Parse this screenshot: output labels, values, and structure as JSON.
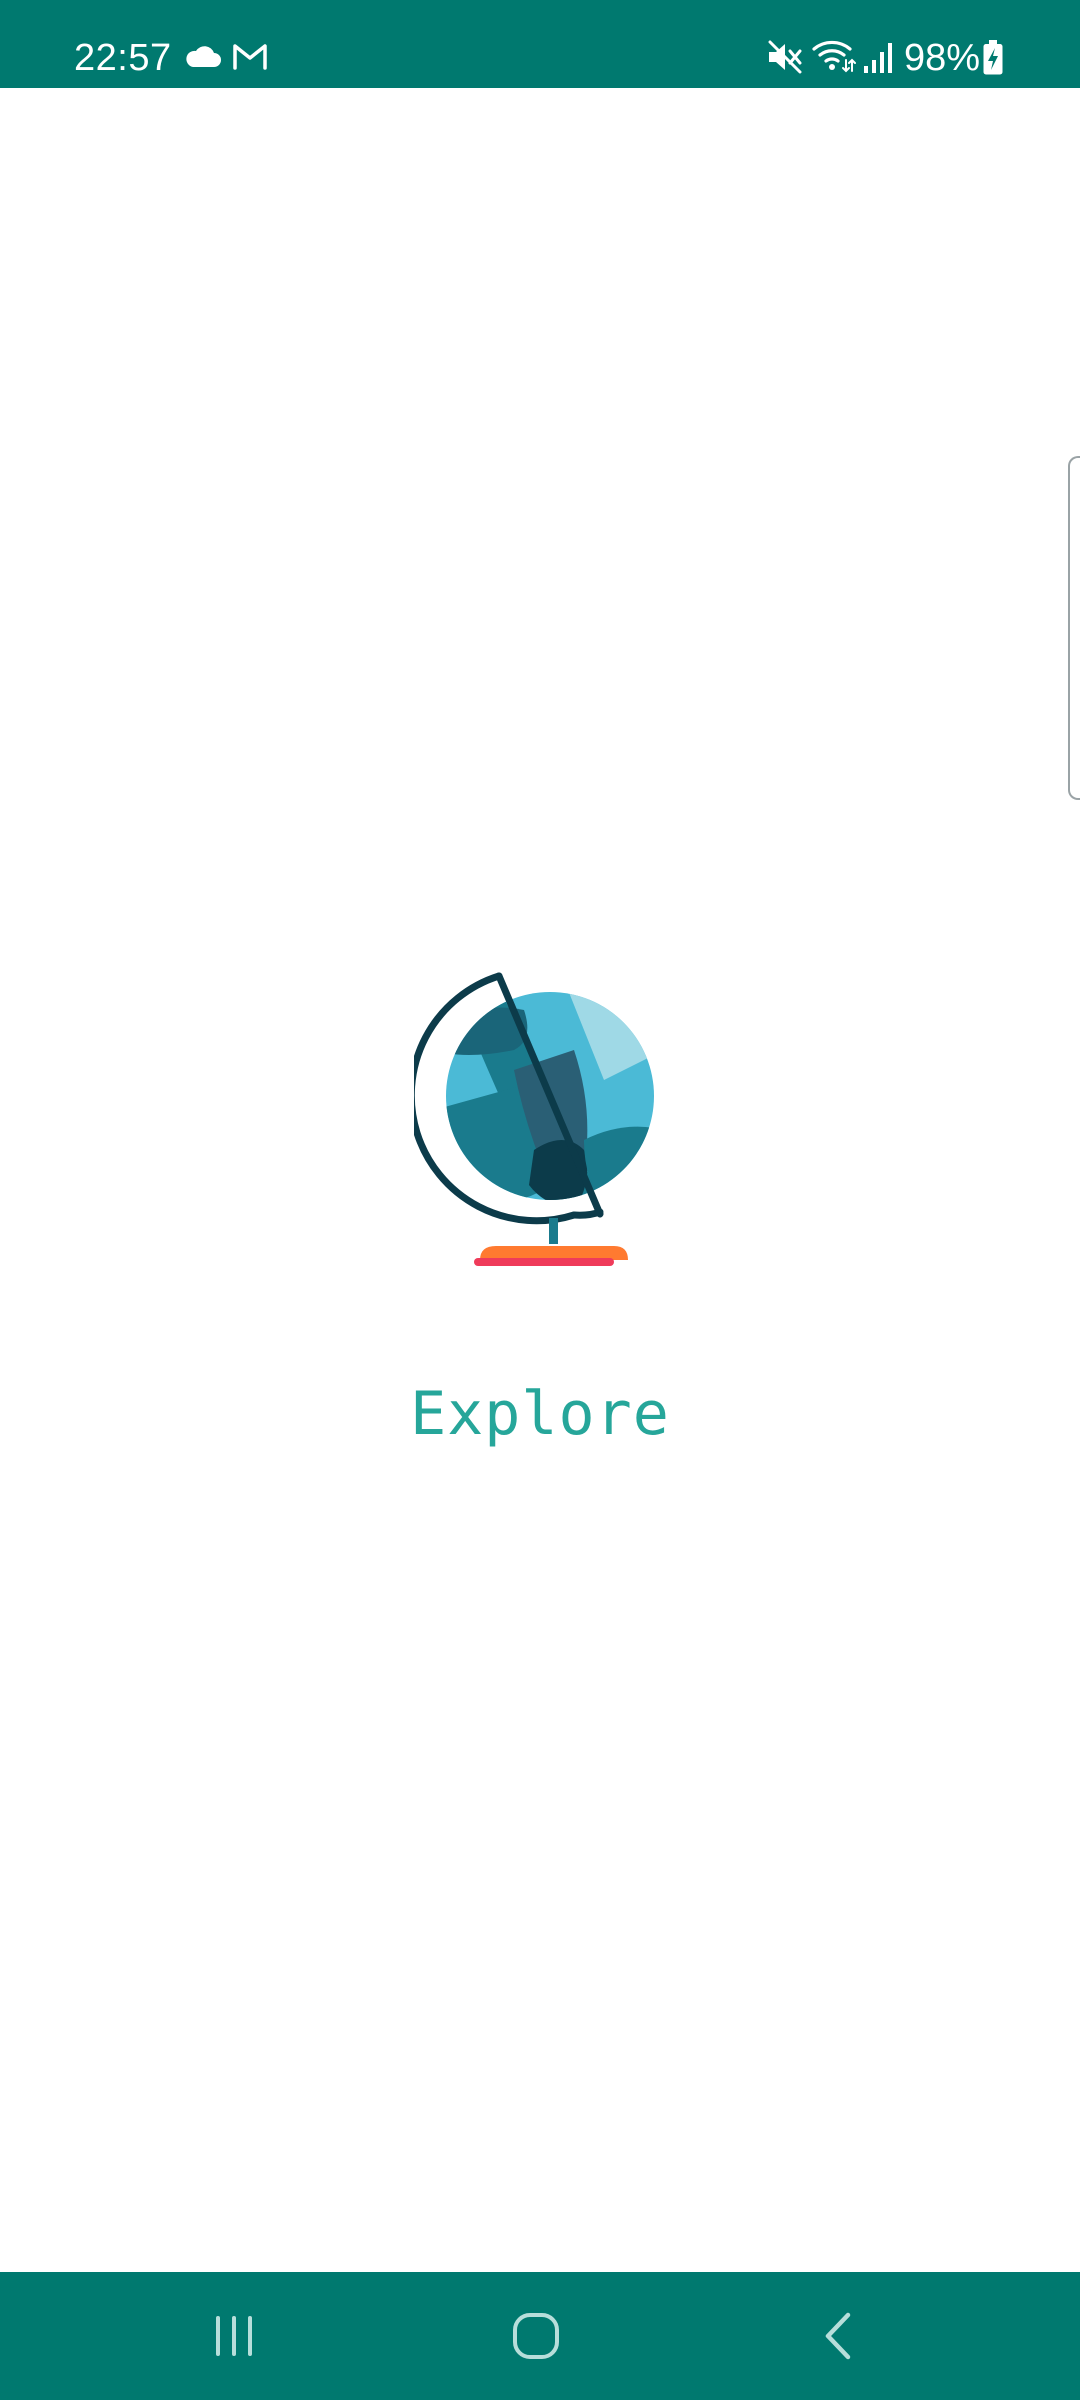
{
  "status_bar": {
    "time": "22:57",
    "battery_percent": "98%",
    "icons": [
      "cloud-icon",
      "gmail-icon",
      "mute-icon",
      "wifi-icon",
      "signal-icon",
      "battery-charging-icon"
    ],
    "background_color": "#00796F"
  },
  "main": {
    "illustration": "globe-icon",
    "title": "Explore",
    "title_color": "#26A69A"
  },
  "nav_bar": {
    "buttons": [
      "recents-icon",
      "home-icon",
      "back-icon"
    ],
    "background_color": "#00796F"
  }
}
